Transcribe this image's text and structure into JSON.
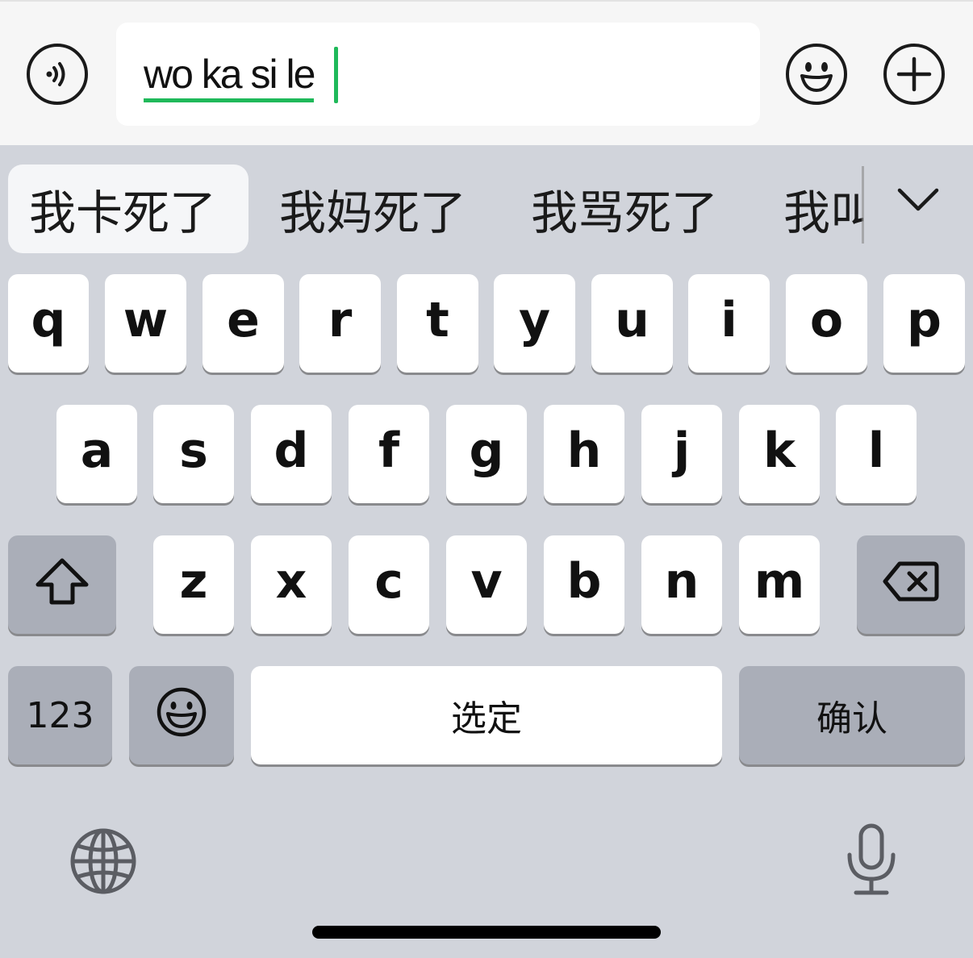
{
  "input": {
    "composing_text": "wo ka si le"
  },
  "candidates": [
    {
      "text": "我卡死了",
      "selected": true
    },
    {
      "text": "我妈死了",
      "selected": false
    },
    {
      "text": "我骂死了",
      "selected": false
    },
    {
      "text": "我叫",
      "selected": false
    }
  ],
  "keyboard": {
    "row1": [
      "q",
      "w",
      "e",
      "r",
      "t",
      "y",
      "u",
      "i",
      "o",
      "p"
    ],
    "row2": [
      "a",
      "s",
      "d",
      "f",
      "g",
      "h",
      "j",
      "k",
      "l"
    ],
    "row3": [
      "z",
      "x",
      "c",
      "v",
      "b",
      "n",
      "m"
    ],
    "numbers_key": "123",
    "space_label": "选定",
    "return_label": "确认"
  },
  "icons": {
    "voice": "voice-message-icon",
    "sticker": "smiley-face-icon",
    "plus": "plus-icon",
    "expand": "chevron-down-icon",
    "shift": "shift-arrow-icon",
    "delete": "backspace-icon",
    "emoji": "emoji-icon",
    "globe": "globe-icon",
    "mic": "microphone-icon"
  },
  "colors": {
    "composing_underline": "#1fb95a",
    "keyboard_bg": "#d1d4db",
    "function_key": "#aaaeb8"
  }
}
